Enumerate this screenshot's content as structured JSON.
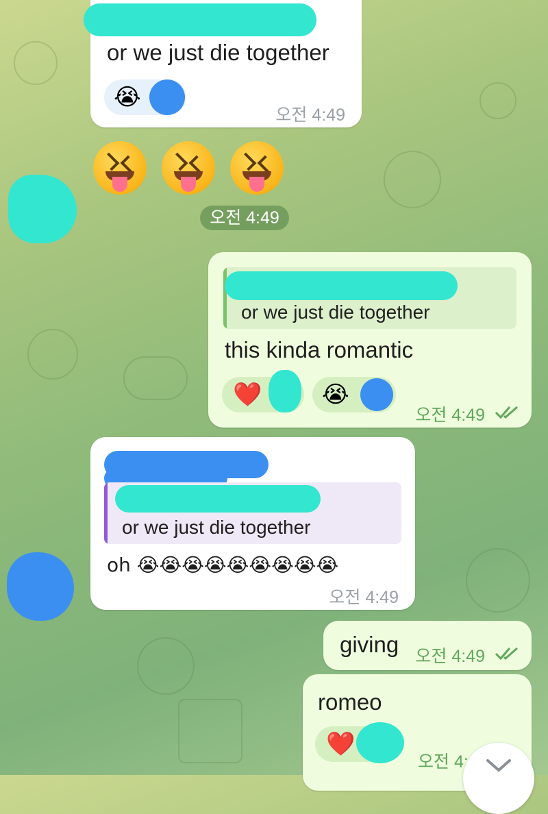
{
  "messages": {
    "m1": {
      "text": "or we just die together",
      "time": "오전 4:49",
      "reaction_emoji": "😭"
    },
    "sticker_row": {
      "emoji": [
        "😝",
        "😝",
        "😝"
      ],
      "time": "오전 4:49"
    },
    "m2": {
      "quote": "or we just die together",
      "text": "this kinda romantic",
      "reaction1": "❤️",
      "reaction2": "😭",
      "time": "오전 4:49"
    },
    "m3": {
      "quote": "or we just die together",
      "text": "oh 😭😭😭😭😭😭😭😭😭",
      "time": "오전 4:49"
    },
    "m4": {
      "text": "giving",
      "time": "오전 4:49"
    },
    "m5": {
      "text": "romeo",
      "reaction1": "❤️",
      "time": "오전 4:4"
    }
  },
  "colors": {
    "incoming_bubble": "#ffffff",
    "outgoing_bubble": "#effdde",
    "outgoing_time": "#5fa85a",
    "reply_bar_out": "#7cc26a",
    "reply_bar_in": "#8e5bd6",
    "redaction_teal": "#33e6d0",
    "redaction_blue": "#3b8ff0"
  },
  "icons": {
    "read": "double-check-icon",
    "scroll": "chevron-down-icon"
  }
}
